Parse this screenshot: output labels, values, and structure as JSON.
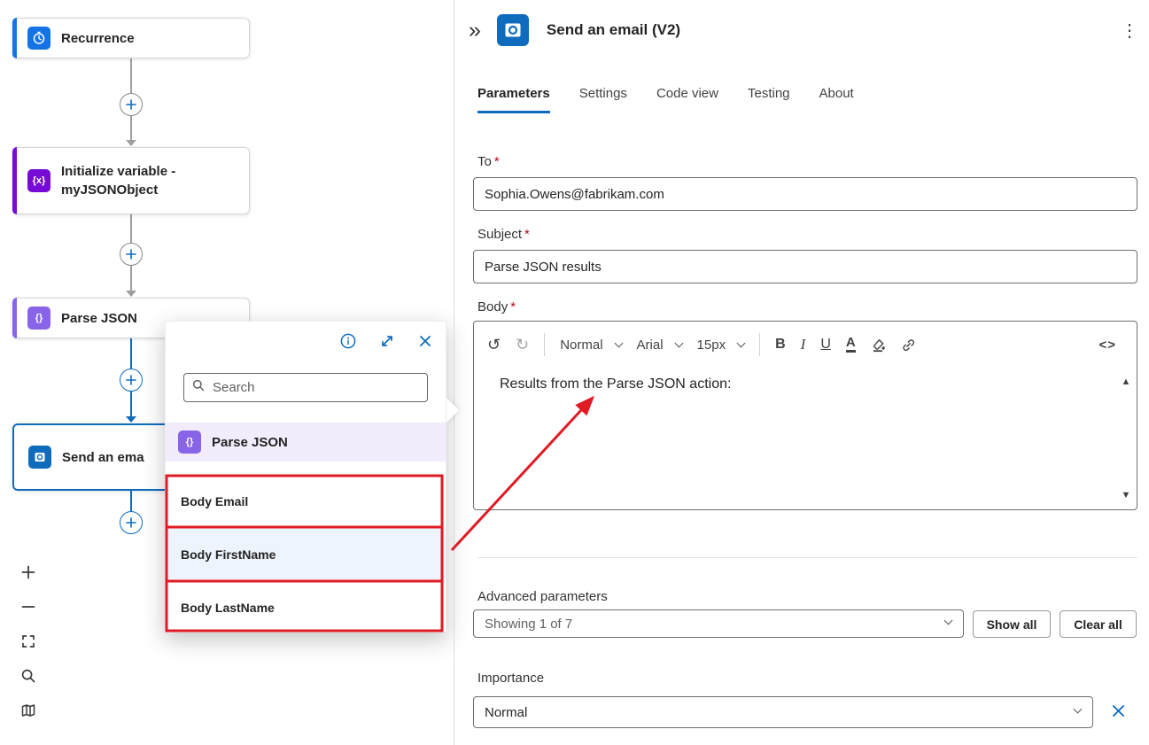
{
  "canvas": {
    "nodes": [
      {
        "label": "Recurrence"
      },
      {
        "label": "Initialize variable - myJSONObject",
        "glyph": "{x}"
      },
      {
        "label": "Parse JSON",
        "glyph": "{}"
      },
      {
        "label": "Send an ema"
      }
    ]
  },
  "popup": {
    "search_placeholder": "Search",
    "group_label": "Parse JSON",
    "group_glyph": "{}",
    "items": [
      "Body Email",
      "Body FirstName",
      "Body LastName"
    ]
  },
  "panel": {
    "title": "Send an email (V2)",
    "tabs": [
      "Parameters",
      "Settings",
      "Code view",
      "Testing",
      "About"
    ],
    "required_mark": "*",
    "to_label": "To",
    "to_value": "Sophia.Owens@fabrikam.com",
    "subject_label": "Subject",
    "subject_value": "Parse JSON results",
    "body_label": "Body",
    "editor": {
      "style_value": "Normal",
      "font_value": "Arial",
      "size_value": "15px",
      "content": "Results from the Parse JSON action:"
    },
    "advanced_label": "Advanced parameters",
    "advanced_value": "Showing 1 of 7",
    "show_all_label": "Show all",
    "clear_all_label": "Clear all",
    "importance_label": "Importance",
    "importance_value": "Normal"
  },
  "icons": {
    "collapse": "»",
    "kebab": "⋮",
    "undo": "↺",
    "redo": "↻",
    "bold": "B",
    "italic": "I",
    "underline": "U",
    "font_color": "A",
    "code": "<>",
    "scroll_up": "▲",
    "scroll_down": "▼"
  },
  "colors": {
    "accent_blue": "#0f6cbd",
    "recurrence_blue": "#1573e6",
    "variable_purple": "#770bd6",
    "parse_json_purple": "#8764e8",
    "annotation_red": "#e01b24"
  }
}
